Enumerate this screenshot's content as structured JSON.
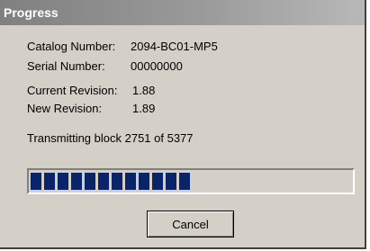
{
  "window": {
    "title": "Progress"
  },
  "info": {
    "catalog_label": "Catalog Number:",
    "catalog_value": "2094-BC01-MP5",
    "serial_label": "Serial Number:",
    "serial_value": "00000000",
    "current_revision_label": "Current Revision:",
    "current_revision_value": "1.88",
    "new_revision_label": "New Revision:",
    "new_revision_value": "1.89"
  },
  "status_text": "Transmitting block 2751 of 5377",
  "progress": {
    "fraction": 0.5116,
    "color": "#0a246a"
  },
  "buttons": {
    "cancel_label": "Cancel"
  }
}
